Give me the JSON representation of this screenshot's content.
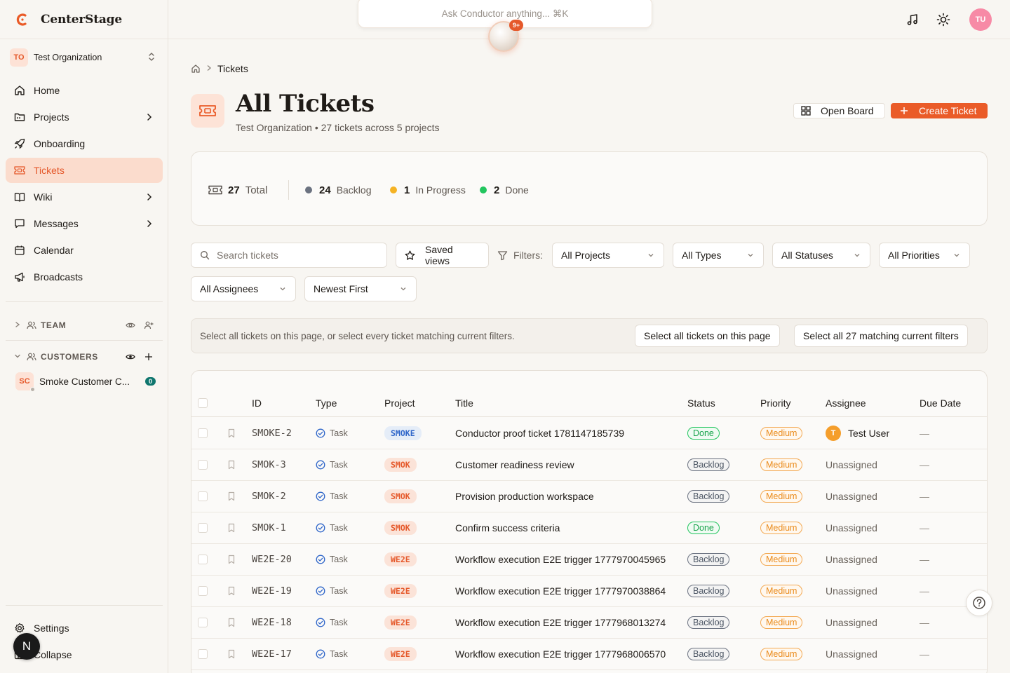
{
  "brand": {
    "name": "CenterStage",
    "accent": "#ea5b28"
  },
  "org": {
    "initials": "TO",
    "name": "Test Organization"
  },
  "nav": [
    {
      "key": "home",
      "label": "Home",
      "icon": "home-icon",
      "chevron": false
    },
    {
      "key": "projects",
      "label": "Projects",
      "icon": "folder-icon",
      "chevron": true
    },
    {
      "key": "onboarding",
      "label": "Onboarding",
      "icon": "rocket-icon",
      "chevron": false
    },
    {
      "key": "tickets",
      "label": "Tickets",
      "icon": "ticket-icon",
      "chevron": false,
      "active": true
    },
    {
      "key": "wiki",
      "label": "Wiki",
      "icon": "book-icon",
      "chevron": true
    },
    {
      "key": "messages",
      "label": "Messages",
      "icon": "message-icon",
      "chevron": true
    },
    {
      "key": "calendar",
      "label": "Calendar",
      "icon": "calendar-icon",
      "chevron": false
    },
    {
      "key": "broadcasts",
      "label": "Broadcasts",
      "icon": "megaphone-icon",
      "chevron": false
    }
  ],
  "sections": {
    "team": {
      "label": "TEAM"
    },
    "customers": {
      "label": "CUSTOMERS"
    }
  },
  "customer": {
    "initials": "SC",
    "name": "Smoke Customer C...",
    "count": "0"
  },
  "footer": {
    "settings": "Settings",
    "collapse": "Collapse"
  },
  "helper_initial": "N",
  "topbar": {
    "conductor_placeholder": "Ask Conductor anything... ⌘K",
    "conductor_badge": "9+",
    "user_initials": "TU"
  },
  "breadcrumb": {
    "current": "Tickets"
  },
  "page": {
    "title": "All Tickets",
    "subtitle": "Test Organization • 27 tickets across 5 projects",
    "open_board": "Open Board",
    "create_ticket": "Create Ticket"
  },
  "stats": {
    "total": {
      "value": "27",
      "label": "Total"
    },
    "backlog": {
      "value": "24",
      "label": "Backlog",
      "color": "#6b7280"
    },
    "in_progress": {
      "value": "1",
      "label": "In Progress",
      "color": "#f5b324"
    },
    "done": {
      "value": "2",
      "label": "Done",
      "color": "#22c55e"
    }
  },
  "filters": {
    "search_placeholder": "Search tickets",
    "saved_views": "Saved views",
    "filters_label": "Filters:",
    "projects": "All Projects",
    "types": "All Types",
    "statuses": "All Statuses",
    "priorities": "All Priorities",
    "assignees": "All Assignees",
    "sort": "Newest First"
  },
  "selection": {
    "hint": "Select all tickets on this page, or select every ticket matching current filters.",
    "page_btn": "Select all tickets on this page",
    "all_btn": "Select all 27 matching current filters"
  },
  "table": {
    "headers": {
      "id": "ID",
      "type": "Type",
      "project": "Project",
      "title": "Title",
      "status": "Status",
      "priority": "Priority",
      "assignee": "Assignee",
      "due": "Due Date"
    },
    "rows": [
      {
        "id": "SMOKE-2",
        "type": "Task",
        "project": "SMOKE",
        "pclass": "smoke",
        "title": "Conductor proof ticket 1781147185739",
        "status": "Done",
        "sclass": "done",
        "priority": "Medium",
        "assignee": "Test User",
        "assignee_initial": "T",
        "due": "—"
      },
      {
        "id": "SMOK-3",
        "type": "Task",
        "project": "SMOK",
        "pclass": "smok",
        "title": "Customer readiness review",
        "status": "Backlog",
        "sclass": "backlog",
        "priority": "Medium",
        "assignee": "Unassigned",
        "due": "—"
      },
      {
        "id": "SMOK-2",
        "type": "Task",
        "project": "SMOK",
        "pclass": "smok",
        "title": "Provision production workspace",
        "status": "Backlog",
        "sclass": "backlog",
        "priority": "Medium",
        "assignee": "Unassigned",
        "due": "—"
      },
      {
        "id": "SMOK-1",
        "type": "Task",
        "project": "SMOK",
        "pclass": "smok",
        "title": "Confirm success criteria",
        "status": "Done",
        "sclass": "done",
        "priority": "Medium",
        "assignee": "Unassigned",
        "due": "—"
      },
      {
        "id": "WE2E-20",
        "type": "Task",
        "project": "WE2E",
        "pclass": "we2e",
        "title": "Workflow execution E2E trigger 1777970045965",
        "status": "Backlog",
        "sclass": "backlog",
        "priority": "Medium",
        "assignee": "Unassigned",
        "due": "—"
      },
      {
        "id": "WE2E-19",
        "type": "Task",
        "project": "WE2E",
        "pclass": "we2e",
        "title": "Workflow execution E2E trigger 1777970038864",
        "status": "Backlog",
        "sclass": "backlog",
        "priority": "Medium",
        "assignee": "Unassigned",
        "due": "—"
      },
      {
        "id": "WE2E-18",
        "type": "Task",
        "project": "WE2E",
        "pclass": "we2e",
        "title": "Workflow execution E2E trigger 1777968013274",
        "status": "Backlog",
        "sclass": "backlog",
        "priority": "Medium",
        "assignee": "Unassigned",
        "due": "—"
      },
      {
        "id": "WE2E-17",
        "type": "Task",
        "project": "WE2E",
        "pclass": "we2e",
        "title": "Workflow execution E2E trigger 1777968006570",
        "status": "Backlog",
        "sclass": "backlog",
        "priority": "Medium",
        "assignee": "Unassigned",
        "due": "—"
      }
    ]
  }
}
